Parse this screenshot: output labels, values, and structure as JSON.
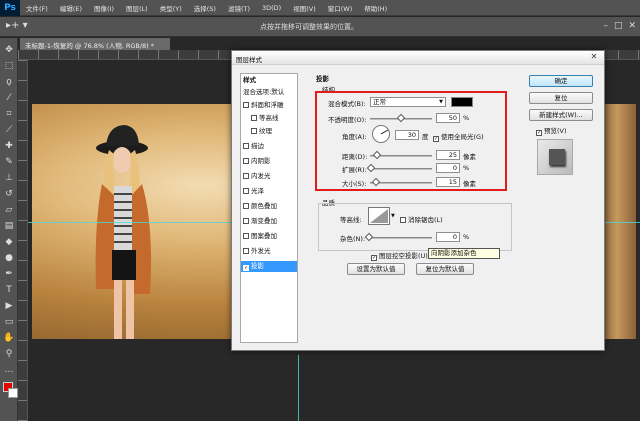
{
  "app": {
    "logo": "Ps",
    "menus": [
      "文件(F)",
      "编辑(E)",
      "图像(I)",
      "图层(L)",
      "类型(Y)",
      "选择(S)",
      "滤镜(T)",
      "3D(D)",
      "视图(V)",
      "窗口(W)",
      "帮助(H)"
    ],
    "options_hint": "点按并拖移可调整效果的位置。",
    "window_controls": [
      "–",
      "□",
      "✕"
    ],
    "document_tab": "未标题-1-恢复的 @ 76.8% (人物, RGB/8) *"
  },
  "colors": {
    "foreground": "#e60000",
    "background": "#ffffff",
    "accent": "#3399ff",
    "highlight": "#e31c1c"
  },
  "dialog": {
    "title": "图层样式",
    "close": "✕",
    "styles_header": "样式",
    "styles": [
      {
        "label": "混合选项:默认",
        "checkbox": false
      },
      {
        "label": "斜面和浮雕",
        "checkbox": true,
        "checked": false
      },
      {
        "label": "等高线",
        "checkbox": true,
        "checked": false,
        "indent": true
      },
      {
        "label": "纹理",
        "checkbox": true,
        "checked": false,
        "indent": true
      },
      {
        "label": "描边",
        "checkbox": true,
        "checked": false
      },
      {
        "label": "内阴影",
        "checkbox": true,
        "checked": false
      },
      {
        "label": "内发光",
        "checkbox": true,
        "checked": false
      },
      {
        "label": "光泽",
        "checkbox": true,
        "checked": false
      },
      {
        "label": "颜色叠加",
        "checkbox": true,
        "checked": false
      },
      {
        "label": "渐变叠加",
        "checkbox": true,
        "checked": false
      },
      {
        "label": "图案叠加",
        "checkbox": true,
        "checked": false
      },
      {
        "label": "外发光",
        "checkbox": true,
        "checked": false
      },
      {
        "label": "投影",
        "checkbox": true,
        "checked": true,
        "selected": true
      }
    ],
    "section_title": "投影",
    "structure": {
      "title": "结构",
      "blend_mode_label": "混合模式(B):",
      "blend_mode_value": "正常",
      "shadow_color": "#000000",
      "opacity_label": "不透明度(O):",
      "opacity": "50",
      "opacity_unit": "%",
      "angle_label": "角度(A):",
      "angle": "30",
      "angle_unit": "度",
      "global_light_label": "使用全局光(G)",
      "distance_label": "距离(D):",
      "distance": "25",
      "distance_unit": "像素",
      "spread_label": "扩展(R):",
      "spread": "0",
      "spread_unit": "%",
      "size_label": "大小(S):",
      "size": "15",
      "size_unit": "像素"
    },
    "quality": {
      "title": "品质",
      "contour_label": "等高线:",
      "antialias_label": "消除锯齿(L)",
      "noise_label": "杂色(N):",
      "noise": "0",
      "noise_unit": "%"
    },
    "knockout_label": "图层挖空投影(U)",
    "tooltip": "向阴影添加杂色",
    "set_default": "设置为默认值",
    "reset_default": "复位为默认值",
    "buttons": {
      "ok": "确定",
      "reset": "复位",
      "new_style": "新建样式(W)...",
      "preview": "预览(V)"
    }
  }
}
